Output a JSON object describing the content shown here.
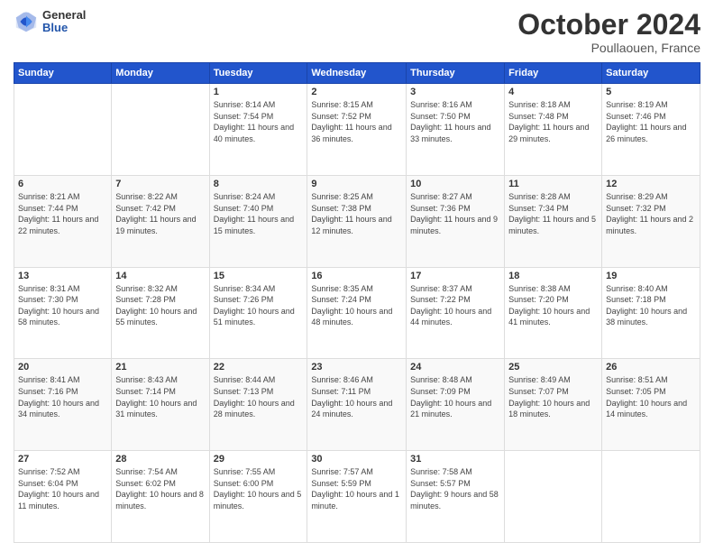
{
  "header": {
    "logo_general": "General",
    "logo_blue": "Blue",
    "month_title": "October 2024",
    "subtitle": "Poullaouen, France"
  },
  "weekdays": [
    "Sunday",
    "Monday",
    "Tuesday",
    "Wednesday",
    "Thursday",
    "Friday",
    "Saturday"
  ],
  "weeks": [
    [
      {
        "day": "",
        "info": ""
      },
      {
        "day": "",
        "info": ""
      },
      {
        "day": "1",
        "info": "Sunrise: 8:14 AM\nSunset: 7:54 PM\nDaylight: 11 hours and 40 minutes."
      },
      {
        "day": "2",
        "info": "Sunrise: 8:15 AM\nSunset: 7:52 PM\nDaylight: 11 hours and 36 minutes."
      },
      {
        "day": "3",
        "info": "Sunrise: 8:16 AM\nSunset: 7:50 PM\nDaylight: 11 hours and 33 minutes."
      },
      {
        "day": "4",
        "info": "Sunrise: 8:18 AM\nSunset: 7:48 PM\nDaylight: 11 hours and 29 minutes."
      },
      {
        "day": "5",
        "info": "Sunrise: 8:19 AM\nSunset: 7:46 PM\nDaylight: 11 hours and 26 minutes."
      }
    ],
    [
      {
        "day": "6",
        "info": "Sunrise: 8:21 AM\nSunset: 7:44 PM\nDaylight: 11 hours and 22 minutes."
      },
      {
        "day": "7",
        "info": "Sunrise: 8:22 AM\nSunset: 7:42 PM\nDaylight: 11 hours and 19 minutes."
      },
      {
        "day": "8",
        "info": "Sunrise: 8:24 AM\nSunset: 7:40 PM\nDaylight: 11 hours and 15 minutes."
      },
      {
        "day": "9",
        "info": "Sunrise: 8:25 AM\nSunset: 7:38 PM\nDaylight: 11 hours and 12 minutes."
      },
      {
        "day": "10",
        "info": "Sunrise: 8:27 AM\nSunset: 7:36 PM\nDaylight: 11 hours and 9 minutes."
      },
      {
        "day": "11",
        "info": "Sunrise: 8:28 AM\nSunset: 7:34 PM\nDaylight: 11 hours and 5 minutes."
      },
      {
        "day": "12",
        "info": "Sunrise: 8:29 AM\nSunset: 7:32 PM\nDaylight: 11 hours and 2 minutes."
      }
    ],
    [
      {
        "day": "13",
        "info": "Sunrise: 8:31 AM\nSunset: 7:30 PM\nDaylight: 10 hours and 58 minutes."
      },
      {
        "day": "14",
        "info": "Sunrise: 8:32 AM\nSunset: 7:28 PM\nDaylight: 10 hours and 55 minutes."
      },
      {
        "day": "15",
        "info": "Sunrise: 8:34 AM\nSunset: 7:26 PM\nDaylight: 10 hours and 51 minutes."
      },
      {
        "day": "16",
        "info": "Sunrise: 8:35 AM\nSunset: 7:24 PM\nDaylight: 10 hours and 48 minutes."
      },
      {
        "day": "17",
        "info": "Sunrise: 8:37 AM\nSunset: 7:22 PM\nDaylight: 10 hours and 44 minutes."
      },
      {
        "day": "18",
        "info": "Sunrise: 8:38 AM\nSunset: 7:20 PM\nDaylight: 10 hours and 41 minutes."
      },
      {
        "day": "19",
        "info": "Sunrise: 8:40 AM\nSunset: 7:18 PM\nDaylight: 10 hours and 38 minutes."
      }
    ],
    [
      {
        "day": "20",
        "info": "Sunrise: 8:41 AM\nSunset: 7:16 PM\nDaylight: 10 hours and 34 minutes."
      },
      {
        "day": "21",
        "info": "Sunrise: 8:43 AM\nSunset: 7:14 PM\nDaylight: 10 hours and 31 minutes."
      },
      {
        "day": "22",
        "info": "Sunrise: 8:44 AM\nSunset: 7:13 PM\nDaylight: 10 hours and 28 minutes."
      },
      {
        "day": "23",
        "info": "Sunrise: 8:46 AM\nSunset: 7:11 PM\nDaylight: 10 hours and 24 minutes."
      },
      {
        "day": "24",
        "info": "Sunrise: 8:48 AM\nSunset: 7:09 PM\nDaylight: 10 hours and 21 minutes."
      },
      {
        "day": "25",
        "info": "Sunrise: 8:49 AM\nSunset: 7:07 PM\nDaylight: 10 hours and 18 minutes."
      },
      {
        "day": "26",
        "info": "Sunrise: 8:51 AM\nSunset: 7:05 PM\nDaylight: 10 hours and 14 minutes."
      }
    ],
    [
      {
        "day": "27",
        "info": "Sunrise: 7:52 AM\nSunset: 6:04 PM\nDaylight: 10 hours and 11 minutes."
      },
      {
        "day": "28",
        "info": "Sunrise: 7:54 AM\nSunset: 6:02 PM\nDaylight: 10 hours and 8 minutes."
      },
      {
        "day": "29",
        "info": "Sunrise: 7:55 AM\nSunset: 6:00 PM\nDaylight: 10 hours and 5 minutes."
      },
      {
        "day": "30",
        "info": "Sunrise: 7:57 AM\nSunset: 5:59 PM\nDaylight: 10 hours and 1 minute."
      },
      {
        "day": "31",
        "info": "Sunrise: 7:58 AM\nSunset: 5:57 PM\nDaylight: 9 hours and 58 minutes."
      },
      {
        "day": "",
        "info": ""
      },
      {
        "day": "",
        "info": ""
      }
    ]
  ]
}
